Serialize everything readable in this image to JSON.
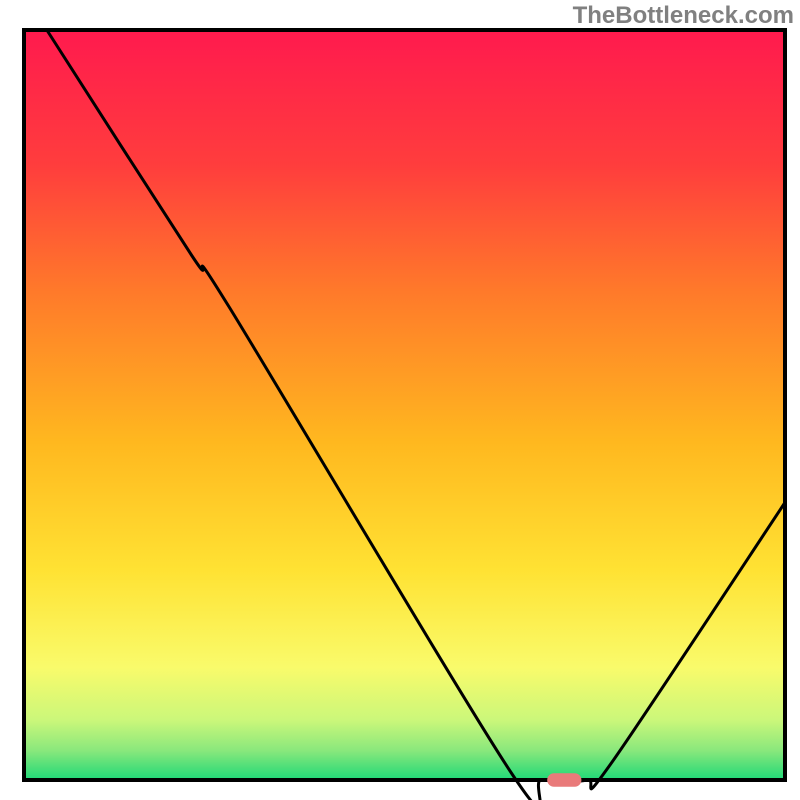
{
  "watermark": "TheBottleneck.com",
  "chart_data": {
    "type": "line",
    "title": "",
    "xlabel": "",
    "ylabel": "",
    "xlim": [
      0,
      100
    ],
    "ylim": [
      0,
      100
    ],
    "background": {
      "description": "Vertical rainbow gradient inside plot area: red/pink at top transitioning through orange, yellow, yellow-green, to green at bottom",
      "stops": [
        {
          "offset": 0.0,
          "color": "#ff1a4e"
        },
        {
          "offset": 0.18,
          "color": "#ff3d3d"
        },
        {
          "offset": 0.35,
          "color": "#ff7a2a"
        },
        {
          "offset": 0.55,
          "color": "#ffb81f"
        },
        {
          "offset": 0.72,
          "color": "#ffe233"
        },
        {
          "offset": 0.85,
          "color": "#f9fb6b"
        },
        {
          "offset": 0.92,
          "color": "#cbf77a"
        },
        {
          "offset": 0.96,
          "color": "#8be87c"
        },
        {
          "offset": 1.0,
          "color": "#1fd877"
        }
      ]
    },
    "series": [
      {
        "name": "bottleneck-curve",
        "color": "#000000",
        "points": [
          {
            "x": 3,
            "y": 100
          },
          {
            "x": 22,
            "y": 70
          },
          {
            "x": 27,
            "y": 63
          },
          {
            "x": 64,
            "y": 1
          },
          {
            "x": 68,
            "y": 0
          },
          {
            "x": 74,
            "y": 0
          },
          {
            "x": 77,
            "y": 2
          },
          {
            "x": 100,
            "y": 37
          }
        ]
      }
    ],
    "marker": {
      "name": "optimal-pill",
      "x": 71,
      "y": 0,
      "color": "#e97a7a",
      "width_pct": 4.5,
      "height_pct": 1.8
    },
    "frame": {
      "color": "#000000",
      "thickness": 4
    }
  }
}
